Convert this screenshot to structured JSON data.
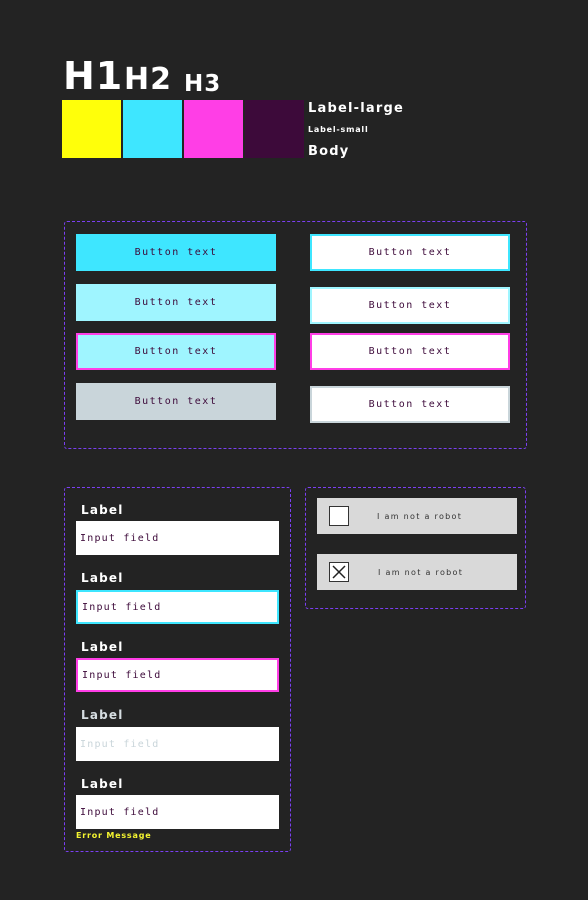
{
  "typography": {
    "h1": "H1",
    "h2": "H2",
    "h3": "H3",
    "label_large": "Label-large",
    "label_small": "Label-small",
    "body": "Body"
  },
  "palette": [
    {
      "name": "yellow",
      "hex": "#ffff0a"
    },
    {
      "name": "cyan",
      "hex": "#3ee6ff"
    },
    {
      "name": "magenta",
      "hex": "#ff3ee6"
    },
    {
      "name": "dark-purple",
      "hex": "#3d0a3a"
    }
  ],
  "buttons": {
    "primary_default": "Button text",
    "primary_hover": "Button text",
    "primary_focus": "Button text",
    "primary_disabled": "Button text",
    "secondary_default": "Button text",
    "secondary_hover": "Button text",
    "secondary_focus": "Button text",
    "secondary_disabled": "Button text"
  },
  "inputs": [
    {
      "label": "Label",
      "value": "Input field",
      "state": "default"
    },
    {
      "label": "Label",
      "value": "Input field",
      "state": "hover"
    },
    {
      "label": "Label",
      "value": "Input field",
      "state": "focus"
    },
    {
      "label": "Label",
      "placeholder": "Input field",
      "state": "disabled"
    },
    {
      "label": "Label",
      "value": "Input field",
      "state": "error"
    }
  ],
  "error_message": "Error Message",
  "captcha": [
    {
      "text": "I am not a robot",
      "checked": false
    },
    {
      "text": "I am not a robot",
      "checked": true
    }
  ]
}
